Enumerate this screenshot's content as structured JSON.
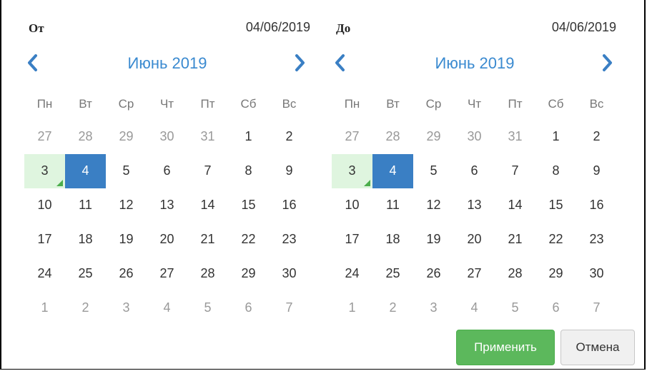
{
  "left": {
    "label": "От",
    "date": "04/06/2019",
    "month_title": "Июнь 2019"
  },
  "right": {
    "label": "До",
    "date": "04/06/2019",
    "month_title": "Июнь 2019"
  },
  "weekdays": [
    "Пн",
    "Вт",
    "Ср",
    "Чт",
    "Пт",
    "Сб",
    "Вс"
  ],
  "weeks": [
    [
      "27",
      "28",
      "29",
      "30",
      "31",
      "1",
      "2"
    ],
    [
      "3",
      "4",
      "5",
      "6",
      "7",
      "8",
      "9"
    ],
    [
      "10",
      "11",
      "12",
      "13",
      "14",
      "15",
      "16"
    ],
    [
      "17",
      "18",
      "19",
      "20",
      "21",
      "22",
      "23"
    ],
    [
      "24",
      "25",
      "26",
      "27",
      "28",
      "29",
      "30"
    ],
    [
      "1",
      "2",
      "3",
      "4",
      "5",
      "6",
      "7"
    ]
  ],
  "muted_cells": [
    [
      0,
      0
    ],
    [
      0,
      1
    ],
    [
      0,
      2
    ],
    [
      0,
      3
    ],
    [
      0,
      4
    ],
    [
      5,
      0
    ],
    [
      5,
      1
    ],
    [
      5,
      2
    ],
    [
      5,
      3
    ],
    [
      5,
      4
    ],
    [
      5,
      5
    ],
    [
      5,
      6
    ]
  ],
  "today_cell": [
    1,
    0
  ],
  "selected_cell": [
    1,
    1
  ],
  "icons": {
    "prev": "chevron-left-icon",
    "next": "chevron-right-icon"
  },
  "colors": {
    "accent": "#3a8ad0",
    "selected": "#3a7fc4",
    "today": "#dff5df",
    "apply": "#5cb85c"
  },
  "buttons": {
    "apply": "Применить",
    "cancel": "Отмена"
  }
}
